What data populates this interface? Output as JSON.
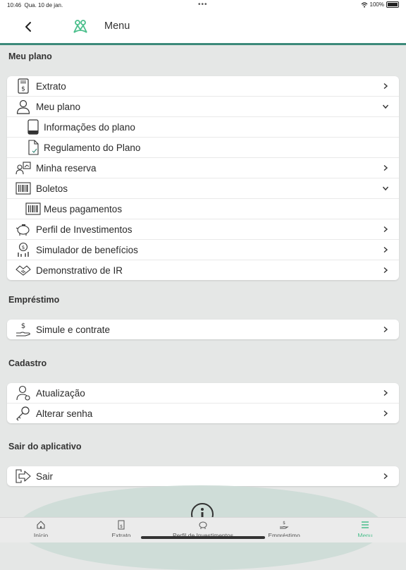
{
  "status_bar": {
    "time": "10:46",
    "date": "Qua. 10 de jan.",
    "battery": "100%"
  },
  "header": {
    "title": "Menu"
  },
  "sections": {
    "meu_plano": {
      "title": "Meu plano",
      "items": [
        {
          "label": "Extrato",
          "icon": "statement-icon",
          "chevron": "right"
        },
        {
          "label": "Meu plano",
          "icon": "person-icon",
          "chevron": "down"
        },
        {
          "label": "Informações do plano",
          "icon": "document-icon",
          "chevron": "none"
        },
        {
          "label": "Regulamento do Plano",
          "icon": "document-check-icon",
          "chevron": "none"
        },
        {
          "label": "Minha reserva",
          "icon": "reserve-icon",
          "chevron": "right"
        },
        {
          "label": "Boletos",
          "icon": "barcode-icon",
          "chevron": "down"
        },
        {
          "label": "Meus pagamentos",
          "icon": "barcode-icon",
          "chevron": "none"
        },
        {
          "label": "Perfil de Investimentos",
          "icon": "piggy-bank-icon",
          "chevron": "right"
        },
        {
          "label": "Simulador de benefícios",
          "icon": "simulator-icon",
          "chevron": "right"
        },
        {
          "label": "Demonstrativo de IR",
          "icon": "handshake-icon",
          "chevron": "right"
        }
      ]
    },
    "emprestimo": {
      "title": "Empréstimo",
      "items": [
        {
          "label": "Simule e contrate",
          "icon": "hand-money-icon",
          "chevron": "right"
        }
      ]
    },
    "cadastro": {
      "title": "Cadastro",
      "items": [
        {
          "label": "Atualização",
          "icon": "person-update-icon",
          "chevron": "right"
        },
        {
          "label": "Alterar senha",
          "icon": "key-icon",
          "chevron": "right"
        }
      ]
    },
    "sair": {
      "title": "Sair do aplicativo",
      "items": [
        {
          "label": "Sair",
          "icon": "exit-icon",
          "chevron": "right"
        }
      ]
    }
  },
  "tabbar": {
    "tabs": [
      {
        "label": "Início",
        "icon": "home-icon"
      },
      {
        "label": "Extrato",
        "icon": "statement-icon"
      },
      {
        "label": "Perfil de Investimentos",
        "icon": "piggy-bank-icon"
      },
      {
        "label": "Empréstimo",
        "icon": "hand-money-icon"
      },
      {
        "label": "Menu",
        "icon": "menu-icon",
        "active": true
      }
    ]
  },
  "colors": {
    "accent": "#3c8a7a",
    "active_tab": "#4bbf8c",
    "background": "#e5e7e6"
  }
}
